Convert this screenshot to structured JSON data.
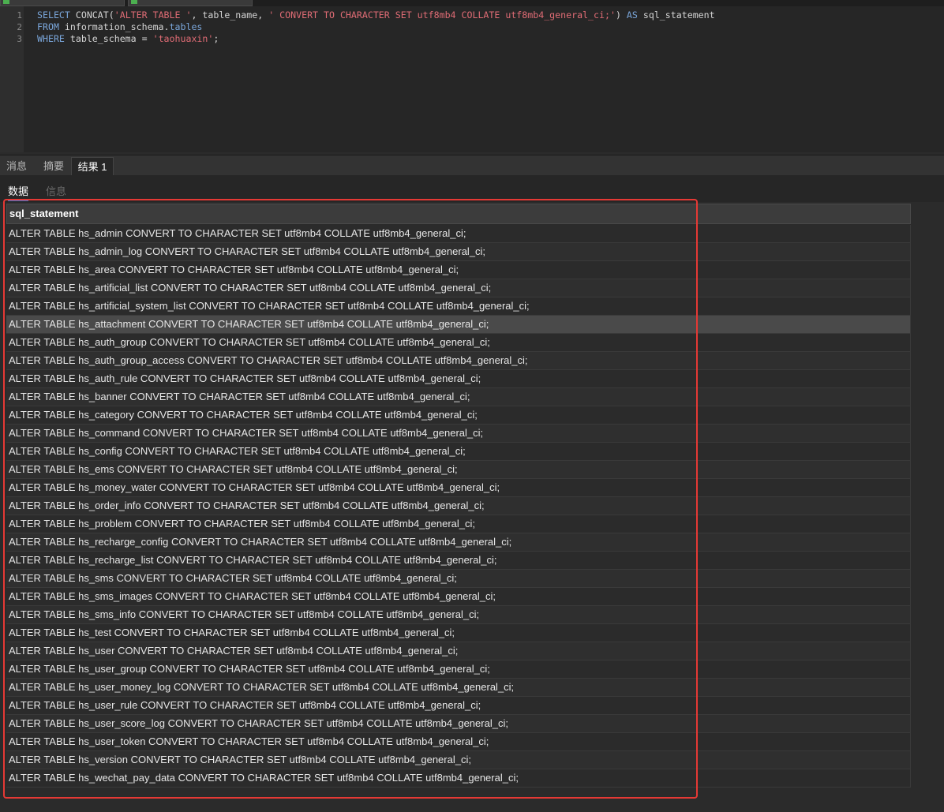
{
  "editor": {
    "line_numbers": [
      "1",
      "2",
      "3"
    ],
    "line1": {
      "kw1": "SELECT",
      "mid1": " CONCAT(",
      "str1": "'ALTER TABLE '",
      "mid2": ", table_name, ",
      "str2": "' CONVERT TO CHARACTER SET utf8mb4 COLLATE utf8mb4_general_ci;'",
      "mid3": ") ",
      "kw2": "AS",
      "mid4": " sql_statement"
    },
    "line2": {
      "kw1": "FROM",
      "mid1": " information_schema.",
      "fn": "tables"
    },
    "line3": {
      "kw1": "WHERE",
      "mid1": " table_schema = ",
      "str1": "'taohuaxin'",
      "mid2": ";"
    }
  },
  "tabs": [
    {
      "label": "消息"
    },
    {
      "label": "摘要"
    },
    {
      "label": "结果 1"
    }
  ],
  "subtabs": [
    {
      "label": "数据"
    },
    {
      "label": "信息"
    }
  ],
  "grid": {
    "column": "sql_statement",
    "rows": [
      "ALTER TABLE hs_admin CONVERT TO CHARACTER SET utf8mb4 COLLATE utf8mb4_general_ci;",
      "ALTER TABLE hs_admin_log CONVERT TO CHARACTER SET utf8mb4 COLLATE utf8mb4_general_ci;",
      "ALTER TABLE hs_area CONVERT TO CHARACTER SET utf8mb4 COLLATE utf8mb4_general_ci;",
      "ALTER TABLE hs_artificial_list CONVERT TO CHARACTER SET utf8mb4 COLLATE utf8mb4_general_ci;",
      "ALTER TABLE hs_artificial_system_list CONVERT TO CHARACTER SET utf8mb4 COLLATE utf8mb4_general_ci;",
      "ALTER TABLE hs_attachment CONVERT TO CHARACTER SET utf8mb4 COLLATE utf8mb4_general_ci;",
      "ALTER TABLE hs_auth_group CONVERT TO CHARACTER SET utf8mb4 COLLATE utf8mb4_general_ci;",
      "ALTER TABLE hs_auth_group_access CONVERT TO CHARACTER SET utf8mb4 COLLATE utf8mb4_general_ci;",
      "ALTER TABLE hs_auth_rule CONVERT TO CHARACTER SET utf8mb4 COLLATE utf8mb4_general_ci;",
      "ALTER TABLE hs_banner CONVERT TO CHARACTER SET utf8mb4 COLLATE utf8mb4_general_ci;",
      "ALTER TABLE hs_category CONVERT TO CHARACTER SET utf8mb4 COLLATE utf8mb4_general_ci;",
      "ALTER TABLE hs_command CONVERT TO CHARACTER SET utf8mb4 COLLATE utf8mb4_general_ci;",
      "ALTER TABLE hs_config CONVERT TO CHARACTER SET utf8mb4 COLLATE utf8mb4_general_ci;",
      "ALTER TABLE hs_ems CONVERT TO CHARACTER SET utf8mb4 COLLATE utf8mb4_general_ci;",
      "ALTER TABLE hs_money_water CONVERT TO CHARACTER SET utf8mb4 COLLATE utf8mb4_general_ci;",
      "ALTER TABLE hs_order_info CONVERT TO CHARACTER SET utf8mb4 COLLATE utf8mb4_general_ci;",
      "ALTER TABLE hs_problem CONVERT TO CHARACTER SET utf8mb4 COLLATE utf8mb4_general_ci;",
      "ALTER TABLE hs_recharge_config CONVERT TO CHARACTER SET utf8mb4 COLLATE utf8mb4_general_ci;",
      "ALTER TABLE hs_recharge_list CONVERT TO CHARACTER SET utf8mb4 COLLATE utf8mb4_general_ci;",
      "ALTER TABLE hs_sms CONVERT TO CHARACTER SET utf8mb4 COLLATE utf8mb4_general_ci;",
      "ALTER TABLE hs_sms_images CONVERT TO CHARACTER SET utf8mb4 COLLATE utf8mb4_general_ci;",
      "ALTER TABLE hs_sms_info CONVERT TO CHARACTER SET utf8mb4 COLLATE utf8mb4_general_ci;",
      "ALTER TABLE hs_test CONVERT TO CHARACTER SET utf8mb4 COLLATE utf8mb4_general_ci;",
      "ALTER TABLE hs_user CONVERT TO CHARACTER SET utf8mb4 COLLATE utf8mb4_general_ci;",
      "ALTER TABLE hs_user_group CONVERT TO CHARACTER SET utf8mb4 COLLATE utf8mb4_general_ci;",
      "ALTER TABLE hs_user_money_log CONVERT TO CHARACTER SET utf8mb4 COLLATE utf8mb4_general_ci;",
      "ALTER TABLE hs_user_rule CONVERT TO CHARACTER SET utf8mb4 COLLATE utf8mb4_general_ci;",
      "ALTER TABLE hs_user_score_log CONVERT TO CHARACTER SET utf8mb4 COLLATE utf8mb4_general_ci;",
      "ALTER TABLE hs_user_token CONVERT TO CHARACTER SET utf8mb4 COLLATE utf8mb4_general_ci;",
      "ALTER TABLE hs_version CONVERT TO CHARACTER SET utf8mb4 COLLATE utf8mb4_general_ci;",
      "ALTER TABLE hs_wechat_pay_data CONVERT TO CHARACTER SET utf8mb4 COLLATE utf8mb4_general_ci;"
    ]
  },
  "colors": {
    "keyword": "#7aa6da",
    "string": "#e06c75",
    "highlight_box": "#e53935",
    "active_subtab": "#3d7bd9"
  }
}
